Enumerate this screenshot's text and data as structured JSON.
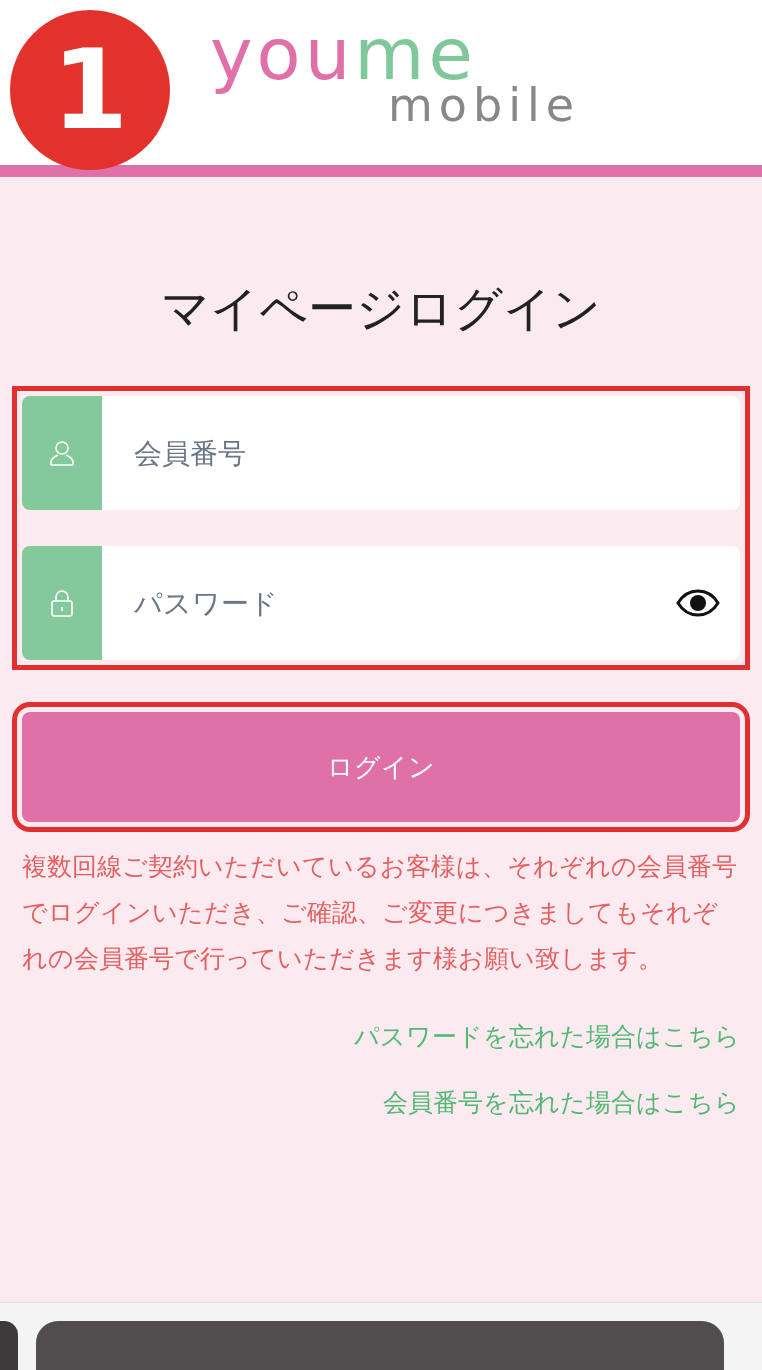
{
  "step_badge": "1",
  "logo": {
    "top": [
      {
        "text": "you",
        "color": "#e070a8"
      },
      {
        "text": "me",
        "color": "#80c89a"
      }
    ],
    "bottom": "mobile"
  },
  "title": "マイページログイン",
  "form": {
    "highlight": true,
    "fields": [
      {
        "kind": "user",
        "placeholder": "会員番号"
      },
      {
        "kind": "password",
        "placeholder": "パスワード"
      }
    ]
  },
  "login_button": {
    "label": "ログイン",
    "highlight": true
  },
  "notice": "複数回線ご契約いただいているお客様は、それぞれの会員番号でログインいただき、ご確認、ご変更につきましてもそれぞれの会員番号で行っていただきます様お願い致します。",
  "links": [
    "パスワードを忘れた場合はこちら",
    "会員番号を忘れた場合はこちら"
  ]
}
